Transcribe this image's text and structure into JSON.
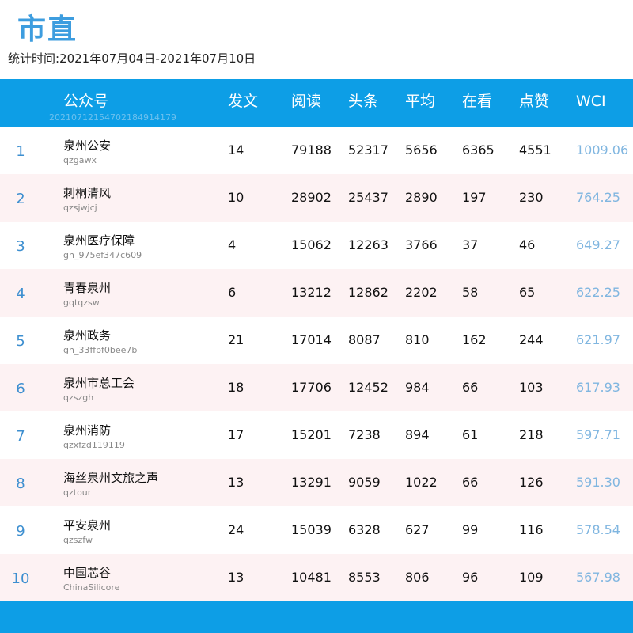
{
  "title": "市直",
  "period": "统计时间:2021年07月04日-2021年07月10日",
  "watermark": "20210712154702184914179",
  "columns": {
    "account": "公众号",
    "posts": "发文",
    "reads": "阅读",
    "headline": "头条",
    "avg": "平均",
    "looking": "在看",
    "likes": "点赞",
    "wci": "WCI"
  },
  "colors": {
    "header_bg": "#0d9ee6",
    "title": "#3d9ddf",
    "rank": "#3d8fd0",
    "wci": "#80b6e0",
    "alt_row_bg": "#fdf2f3"
  },
  "rows": [
    {
      "rank": "1",
      "name": "泉州公安",
      "account": "qzgawx",
      "posts": "14",
      "reads": "79188",
      "headline": "52317",
      "avg": "5656",
      "looking": "6365",
      "likes": "4551",
      "wci": "1009.06"
    },
    {
      "rank": "2",
      "name": "刺桐清风",
      "account": "qzsjwjcj",
      "posts": "10",
      "reads": "28902",
      "headline": "25437",
      "avg": "2890",
      "looking": "197",
      "likes": "230",
      "wci": "764.25"
    },
    {
      "rank": "3",
      "name": "泉州医疗保障",
      "account": "gh_975ef347c609",
      "posts": "4",
      "reads": "15062",
      "headline": "12263",
      "avg": "3766",
      "looking": "37",
      "likes": "46",
      "wci": "649.27"
    },
    {
      "rank": "4",
      "name": "青春泉州",
      "account": "gqtqzsw",
      "posts": "6",
      "reads": "13212",
      "headline": "12862",
      "avg": "2202",
      "looking": "58",
      "likes": "65",
      "wci": "622.25"
    },
    {
      "rank": "5",
      "name": "泉州政务",
      "account": "gh_33ffbf0bee7b",
      "posts": "21",
      "reads": "17014",
      "headline": "8087",
      "avg": "810",
      "looking": "162",
      "likes": "244",
      "wci": "621.97"
    },
    {
      "rank": "6",
      "name": "泉州市总工会",
      "account": "qzszgh",
      "posts": "18",
      "reads": "17706",
      "headline": "12452",
      "avg": "984",
      "looking": "66",
      "likes": "103",
      "wci": "617.93"
    },
    {
      "rank": "7",
      "name": "泉州消防",
      "account": "qzxfzd119119",
      "posts": "17",
      "reads": "15201",
      "headline": "7238",
      "avg": "894",
      "looking": "61",
      "likes": "218",
      "wci": "597.71"
    },
    {
      "rank": "8",
      "name": "海丝泉州文旅之声",
      "account": "qztour",
      "posts": "13",
      "reads": "13291",
      "headline": "9059",
      "avg": "1022",
      "looking": "66",
      "likes": "126",
      "wci": "591.30"
    },
    {
      "rank": "9",
      "name": "平安泉州",
      "account": "qzszfw",
      "posts": "24",
      "reads": "15039",
      "headline": "6328",
      "avg": "627",
      "looking": "99",
      "likes": "116",
      "wci": "578.54"
    },
    {
      "rank": "10",
      "name": "中国芯谷",
      "account": "ChinaSilicore",
      "posts": "13",
      "reads": "10481",
      "headline": "8553",
      "avg": "806",
      "looking": "96",
      "likes": "109",
      "wci": "567.98"
    }
  ]
}
